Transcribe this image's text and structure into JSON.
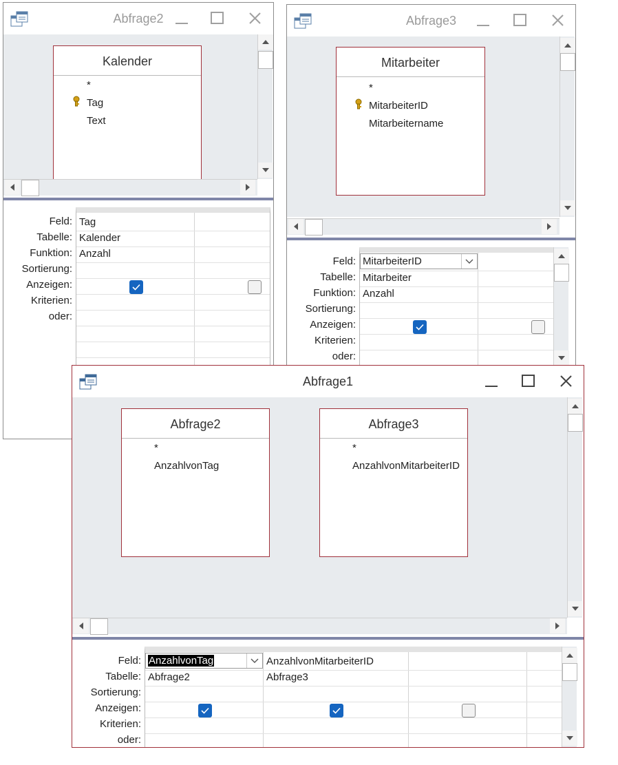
{
  "row_labels": {
    "feld": "Feld:",
    "tabelle": "Tabelle:",
    "funktion": "Funktion:",
    "sortierung": "Sortierung:",
    "anzeigen": "Anzeigen:",
    "kriterien": "Kriterien:",
    "oder": "oder:"
  },
  "windows": {
    "abfrage2": {
      "title": "Abfrage2",
      "table": {
        "name": "Kalender",
        "star": "*",
        "fields": [
          "Tag",
          "Text"
        ]
      },
      "grid": {
        "col1": {
          "feld": "Tag",
          "tabelle": "Kalender",
          "funktion": "Anzahl",
          "anzeigen": true
        },
        "col2_anzeigen": false
      }
    },
    "abfrage3": {
      "title": "Abfrage3",
      "table": {
        "name": "Mitarbeiter",
        "star": "*",
        "fields": [
          "MitarbeiterID",
          "Mitarbeitername"
        ]
      },
      "grid": {
        "col1": {
          "feld": "MitarbeiterID",
          "tabelle": "Mitarbeiter",
          "funktion": "Anzahl",
          "anzeigen": true
        },
        "col2_anzeigen": false
      }
    },
    "abfrage1": {
      "title": "Abfrage1",
      "tables": [
        {
          "name": "Abfrage2",
          "star": "*",
          "fields": [
            "AnzahlvonTag"
          ]
        },
        {
          "name": "Abfrage3",
          "star": "*",
          "fields": [
            "AnzahlvonMitarbeiterID"
          ]
        }
      ],
      "grid": {
        "col1": {
          "feld": "AnzahlvonTag",
          "tabelle": "Abfrage2",
          "anzeigen": true
        },
        "col2": {
          "feld": "AnzahlvonMitarbeiterID",
          "tabelle": "Abfrage3",
          "anzeigen": true
        },
        "col3_anzeigen": false
      }
    }
  },
  "colors": {
    "accent_border": "#a0303a",
    "checkbox_on": "#1565c0",
    "splitter": "#7f86a8",
    "design_bg": "#e8ebee"
  }
}
